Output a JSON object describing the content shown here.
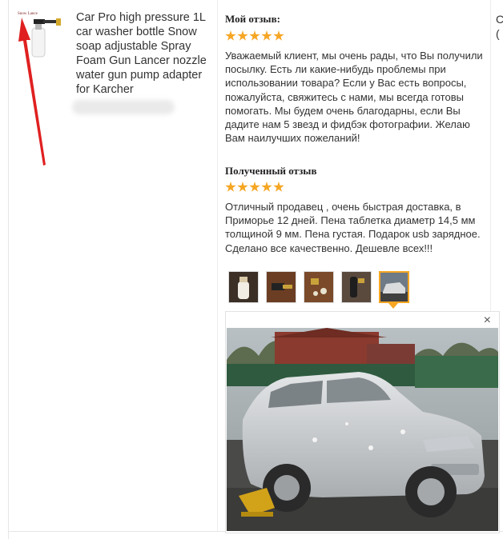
{
  "product": {
    "brand_mark": "Snow Lance",
    "title": "Car Pro high pressure 1L car washer bottle Snow soap adjustable Spray Foam Gun Lancer nozzle water gun pump adapter for Karcher"
  },
  "my_review": {
    "heading": "Мой отзыв:",
    "rating": 5,
    "text": "Уважаемый клиент, мы очень рады, что Вы получили посылку. Есть ли какие-нибудь проблемы при использовании товара? Если у Вас есть вопросы, пожалуйста, свяжитесь с нами, мы всегда готовы помогать. Мы будем очень благодарны, если Вы дадите нам 5 звезд и фидбэк фотографии. Желаю Вам наилучших пожеланий!"
  },
  "received_review": {
    "heading": "Полученный отзыв",
    "rating": 5,
    "text": "Отличный продавец , очень быстрая доставка, в Приморье 12 дней. Пена таблетка диаметр 14,5 мм толщиной 9 мм. Пена густая. Подарок usb зарядное. Сделано все качественно. Дешевле всех!!!"
  },
  "photo_thumbnails": [
    "bottle",
    "lance-parts",
    "nozzle-tablets",
    "foam-gun",
    "foamed-car"
  ],
  "active_thumbnail_index": 4,
  "viewer": {
    "close_label": "×"
  },
  "right_edge": {
    "line1": "С",
    "line2": "("
  },
  "colors": {
    "accent": "#f6a623",
    "arrow": "#e02020"
  }
}
